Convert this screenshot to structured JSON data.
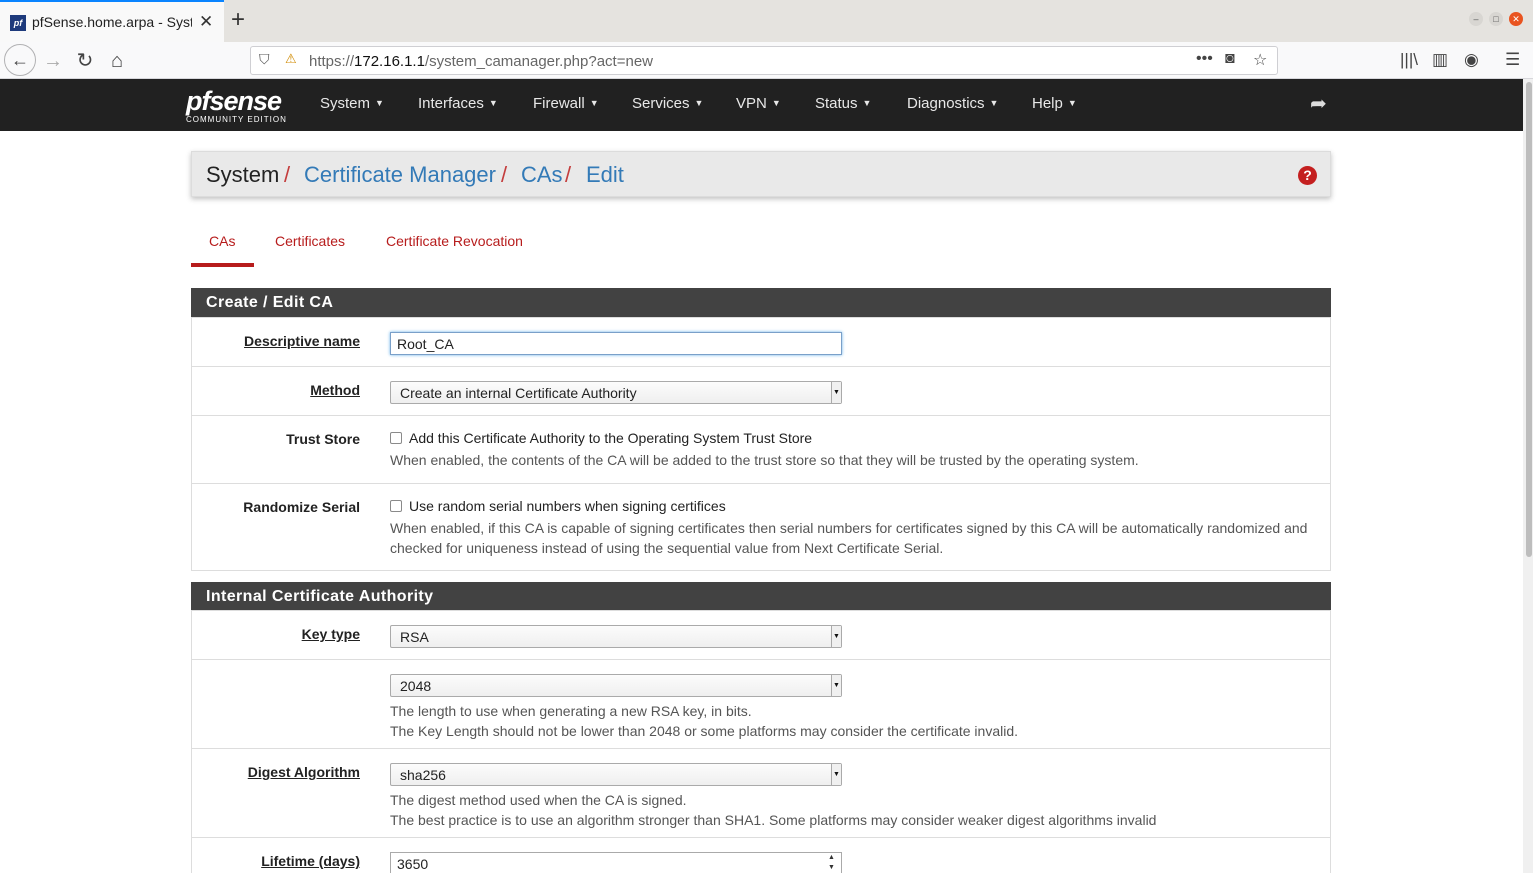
{
  "browser": {
    "tab_title": "pfSense.home.arpa - Syst",
    "url_prefix": "https://",
    "url_host": "172.16.1.1",
    "url_path": "/system_camanager.php?act=new"
  },
  "header": {
    "logo_text": "pfsense",
    "logo_sub": "COMMUNITY EDITION",
    "menu": [
      "System",
      "Interfaces",
      "Firewall",
      "Services",
      "VPN",
      "Status",
      "Diagnostics",
      "Help"
    ]
  },
  "breadcrumb": {
    "system": "System",
    "cert_manager": "Certificate Manager",
    "cas": "CAs",
    "edit": "Edit",
    "sep": "/"
  },
  "tabs": [
    "CAs",
    "Certificates",
    "Certificate Revocation"
  ],
  "create_edit_panel": {
    "title": "Create / Edit CA",
    "descriptive_name_label": "Descriptive name",
    "descriptive_name_value": "Root_CA",
    "method_label": "Method",
    "method_value": "Create an internal Certificate Authority",
    "trust_store_label": "Trust Store",
    "trust_store_checkbox": "Add this Certificate Authority to the Operating System Trust Store",
    "trust_store_help": "When enabled, the contents of the CA will be added to the trust store so that they will be trusted by the operating system.",
    "randomize_serial_label": "Randomize Serial",
    "randomize_serial_checkbox": "Use random serial numbers when signing certifices",
    "randomize_serial_help_1": "When enabled, if this CA is capable of signing certificates then serial numbers for certificates signed by this CA will be automatically randomized and",
    "randomize_serial_help_2": "checked for uniqueness instead of using the sequential value from Next Certificate Serial."
  },
  "internal_ca_panel": {
    "title": "Internal Certificate Authority",
    "key_type_label": "Key type",
    "key_type_value": "RSA",
    "key_length_value": "2048",
    "key_length_help_1": "The length to use when generating a new RSA key, in bits.",
    "key_length_help_2": "The Key Length should not be lower than 2048 or some platforms may consider the certificate invalid.",
    "digest_label": "Digest Algorithm",
    "digest_value": "sha256",
    "digest_help_1": "The digest method used when the CA is signed.",
    "digest_help_2": "The best practice is to use an algorithm stronger than SHA1. Some platforms may consider weaker digest algorithms invalid",
    "lifetime_label": "Lifetime (days)",
    "lifetime_value": "3650"
  },
  "colors": {
    "accent_red": "#b71c1c",
    "link_blue": "#337ab7",
    "header_bg": "#212121",
    "panel_heading": "#424242"
  }
}
